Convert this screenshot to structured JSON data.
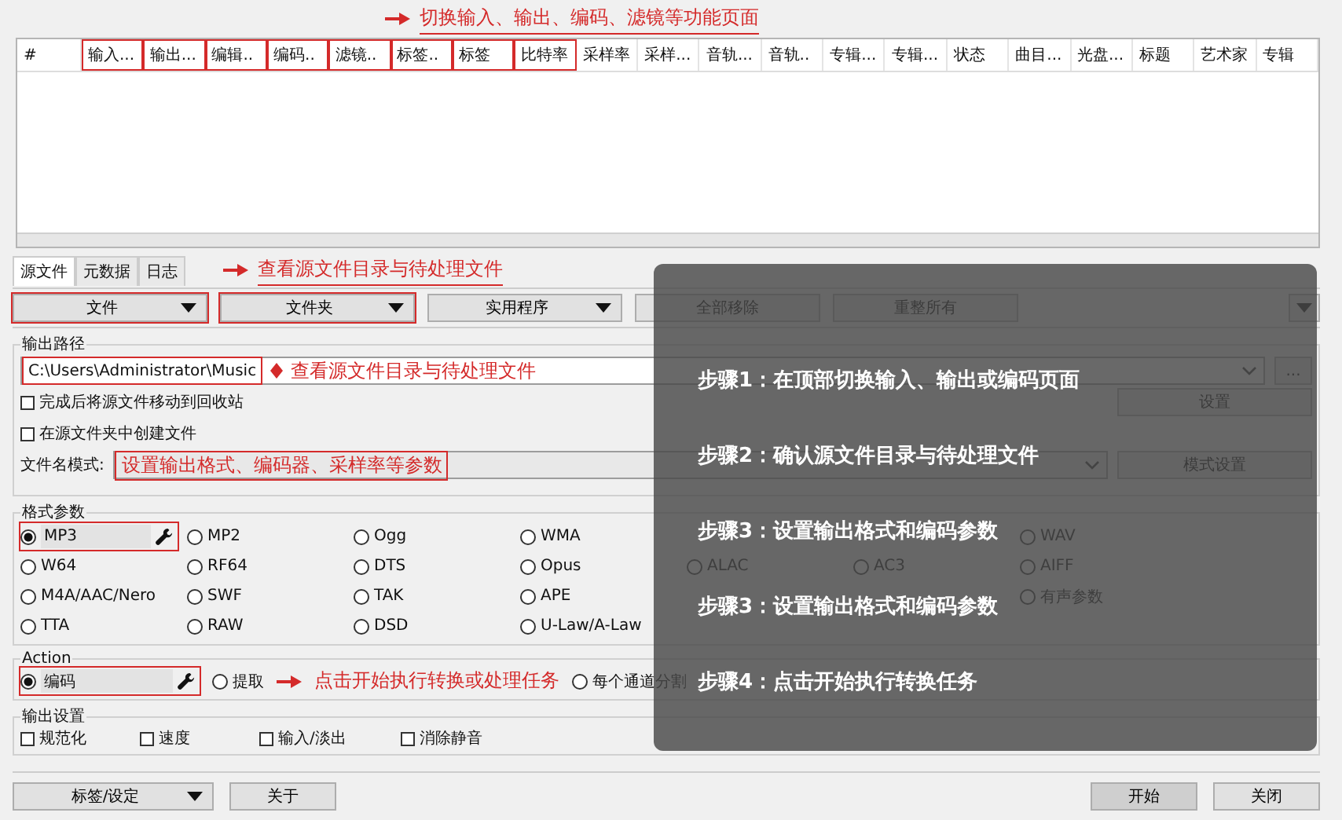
{
  "top_annotation": "切换输入、输出、编码、滤镜等功能页面",
  "table": {
    "columns": [
      {
        "label": "#",
        "highlighted": false
      },
      {
        "label": "输入...",
        "highlighted": true
      },
      {
        "label": "输出...",
        "highlighted": true
      },
      {
        "label": "编辑..",
        "highlighted": true
      },
      {
        "label": "编码..",
        "highlighted": true
      },
      {
        "label": "滤镜..",
        "highlighted": true
      },
      {
        "label": "标签..",
        "highlighted": true
      },
      {
        "label": "标签",
        "highlighted": true
      },
      {
        "label": "比特率",
        "highlighted": true
      },
      {
        "label": "采样率",
        "highlighted": false
      },
      {
        "label": "采样...",
        "highlighted": false
      },
      {
        "label": "音轨...",
        "highlighted": false
      },
      {
        "label": "音轨..",
        "highlighted": false
      },
      {
        "label": "专辑...",
        "highlighted": false
      },
      {
        "label": "专辑...",
        "highlighted": false
      },
      {
        "label": "状态",
        "highlighted": false
      },
      {
        "label": "曲目...",
        "highlighted": false
      },
      {
        "label": "光盘...",
        "highlighted": false
      },
      {
        "label": "标题",
        "highlighted": false
      },
      {
        "label": "艺术家",
        "highlighted": false
      },
      {
        "label": "专辑",
        "highlighted": false
      }
    ]
  },
  "source_tabs": {
    "tabs": [
      {
        "label": "源文件",
        "selected": true
      },
      {
        "label": "元数据",
        "selected": false
      },
      {
        "label": "日志",
        "selected": false
      }
    ],
    "annotation": "查看源文件目录与待处理文件"
  },
  "toolbar": {
    "buttons": [
      {
        "label": "文件",
        "kind": "dropdown",
        "highlighted": true
      },
      {
        "label": "文件夹",
        "kind": "dropdown",
        "highlighted": true
      },
      {
        "label": "实用程序",
        "kind": "dropdown",
        "highlighted": false
      },
      {
        "label": "全部移除",
        "kind": "plain",
        "highlighted": false
      },
      {
        "label": "重整所有",
        "kind": "plain",
        "highlighted": false
      }
    ]
  },
  "output_path": {
    "title": "输出路径",
    "value": "C:\\Users\\Administrator\\Music",
    "annotation": "查看源文件目录与待处理文件",
    "browse_button": "...",
    "options": [
      {
        "label": "完成后将源文件移动到回收站",
        "checked": false
      },
      {
        "label": "在源文件夹中创建文件",
        "checked": false
      }
    ],
    "settings_button": "设置",
    "pattern_label": "文件名模式:",
    "pattern_annotation": "设置输出格式、编码器、采样率等参数",
    "pattern_button": "模式设置"
  },
  "format": {
    "title": "格式参数",
    "rows": [
      [
        {
          "label": "MP3",
          "selected": true,
          "configurable": true
        },
        {
          "label": "MP2",
          "selected": false,
          "configurable": false
        },
        {
          "label": "Ogg",
          "selected": false,
          "configurable": false
        },
        {
          "label": "WMA",
          "selected": false,
          "configurable": false
        },
        {
          "label": "WAV",
          "selected": false,
          "configurable": false
        }
      ],
      [
        {
          "label": "W64",
          "selected": false,
          "configurable": false
        },
        {
          "label": "RF64",
          "selected": false,
          "configurable": false
        },
        {
          "label": "DTS",
          "selected": false,
          "configurable": false
        },
        {
          "label": "Opus",
          "selected": false,
          "configurable": false
        },
        {
          "label": "ALAC",
          "selected": false,
          "configurable": false
        },
        {
          "label": "AC3",
          "selected": false,
          "configurable": false
        },
        {
          "label": "AIFF",
          "selected": false,
          "configurable": false
        }
      ],
      [
        {
          "label": "M4A/AAC/Nero",
          "selected": false,
          "configurable": false
        },
        {
          "label": "SWF",
          "selected": false,
          "configurable": false
        },
        {
          "label": "TAK",
          "selected": false,
          "configurable": false
        },
        {
          "label": "APE",
          "selected": false,
          "configurable": false
        },
        {
          "label": "有声参数",
          "selected": false,
          "configurable": false
        }
      ],
      [
        {
          "label": "TTA",
          "selected": false,
          "configurable": false
        },
        {
          "label": "RAW",
          "selected": false,
          "configurable": false
        },
        {
          "label": "DSD",
          "selected": false,
          "configurable": false
        },
        {
          "label": "U-Law/A-Law",
          "selected": false,
          "configurable": false
        }
      ]
    ]
  },
  "action": {
    "title": "Action",
    "options": [
      {
        "label": "编码",
        "selected": true,
        "configurable": true
      },
      {
        "label": "提取",
        "selected": false,
        "configurable": false
      },
      {
        "label": "每个通道分割",
        "selected": false,
        "configurable": false
      }
    ],
    "annotation": "点击开始执行转换或处理任务"
  },
  "output_settings": {
    "title": "输出设置",
    "options": [
      {
        "label": "规范化",
        "checked": false
      },
      {
        "label": "速度",
        "checked": false
      },
      {
        "label": "输入/淡出",
        "checked": false
      },
      {
        "label": "消除静音",
        "checked": false
      }
    ]
  },
  "steps": [
    "步骤1：在顶部切换输入、输出或编码页面",
    "步骤2：确认源文件目录与待处理文件",
    "步骤3：设置输出格式和编码参数",
    "步骤3：设置输出格式和编码参数",
    "步骤4：点击开始执行转换任务"
  ],
  "footer": {
    "left": [
      {
        "label": "标签/设定",
        "kind": "dropdown",
        "default": false
      },
      {
        "label": "关于",
        "kind": "plain",
        "default": false
      }
    ],
    "right": [
      {
        "label": "开始",
        "default": true
      },
      {
        "label": "关闭",
        "default": false
      }
    ]
  }
}
